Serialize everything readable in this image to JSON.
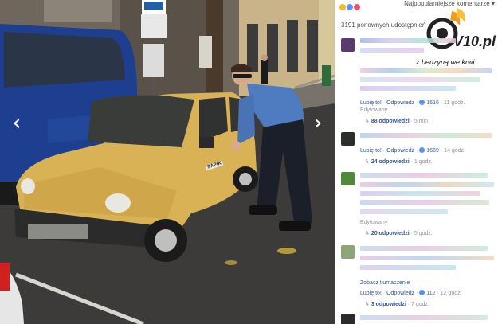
{
  "header": {
    "sort_label": "Najpopularniejsze komentarze",
    "sort_arrow": "▾",
    "shares_text": "3191 ponownych udostępnień"
  },
  "watermark": {
    "text": "V10.pl",
    "color": "#222222",
    "accent": "#f39a1d"
  },
  "overlay_text": "z benzyną we krwi",
  "photo": {
    "plate_text": "SAPIK",
    "prev_arrow": "‹",
    "next_arrow": "›"
  },
  "comments": [
    {
      "actions": {
        "like": "Lubię to!",
        "reply": "Odpowiedz",
        "likes": "1616",
        "time": "11 godz."
      },
      "edited": "Edytowany",
      "replies": {
        "label": "88 odpowiedzi",
        "time": "5 min"
      }
    },
    {
      "actions": {
        "like": "Lubię to!",
        "reply": "Odpowiedz",
        "likes": "1669",
        "time": "14 godz."
      },
      "replies": {
        "label": "24 odpowiedzi",
        "time": "1 godz."
      }
    },
    {
      "actions": {
        "edited": "Edytowany"
      },
      "replies": {
        "label": "20 odpowiedzi",
        "time": "5 godz."
      }
    },
    {
      "see_translation": "Zobacz tłumaczenie",
      "actions": {
        "like": "Lubię to!",
        "reply": "Odpowiedz",
        "likes": "112",
        "time": "12 godz."
      },
      "replies": {
        "label": "3 odpowiedzi",
        "time": "7 godz."
      }
    }
  ],
  "colors": {
    "link": "#365899",
    "muted": "#90949c",
    "car": "#d9b255",
    "like": "#5890ff"
  }
}
